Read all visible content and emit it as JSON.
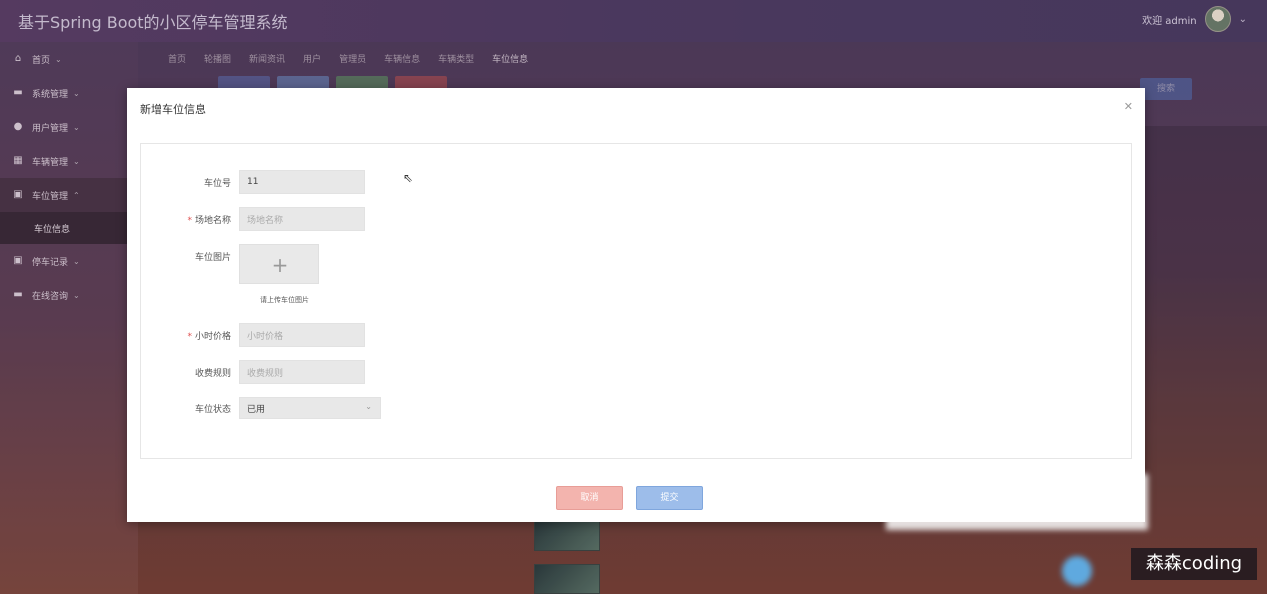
{
  "app": {
    "title": "基于Spring Boot的小区停车管理系统",
    "welcome": "欢迎 admin"
  },
  "sidebar": {
    "items": [
      {
        "label": "首页",
        "icon": "home-icon"
      },
      {
        "label": "系统管理",
        "icon": "grid-icon"
      },
      {
        "label": "用户管理",
        "icon": "drop-icon"
      },
      {
        "label": "车辆管理",
        "icon": "apps-icon"
      },
      {
        "label": "车位管理",
        "icon": "briefcase-icon"
      },
      {
        "label": "停车记录",
        "icon": "briefcase-icon"
      },
      {
        "label": "在线咨询",
        "icon": "grid-icon"
      }
    ],
    "sub_active": "车位信息"
  },
  "tabs": [
    "首页",
    "轮播图",
    "新闻资讯",
    "用户",
    "管理员",
    "车辆信息",
    "车辆类型",
    "车位信息"
  ],
  "toolbar": {
    "search_label": "搜索"
  },
  "modal": {
    "title": "新增车位信息",
    "close_icon": "close-icon",
    "fields": {
      "space_no": {
        "label": "车位号",
        "value": "11"
      },
      "site_name": {
        "label": "场地名称",
        "placeholder": "场地名称"
      },
      "image": {
        "label": "车位图片",
        "hint": "请上传车位图片"
      },
      "hour_price": {
        "label": "小时价格",
        "placeholder": "小时价格"
      },
      "rule": {
        "label": "收费规则",
        "placeholder": "收费规则"
      },
      "status": {
        "label": "车位状态",
        "value": "已用"
      }
    },
    "cancel": "取消",
    "submit": "提交"
  },
  "watermark": "森森coding",
  "colors": {
    "cancel": "#f3b4ae",
    "submit": "#9dbdea",
    "required": "#e05050"
  }
}
